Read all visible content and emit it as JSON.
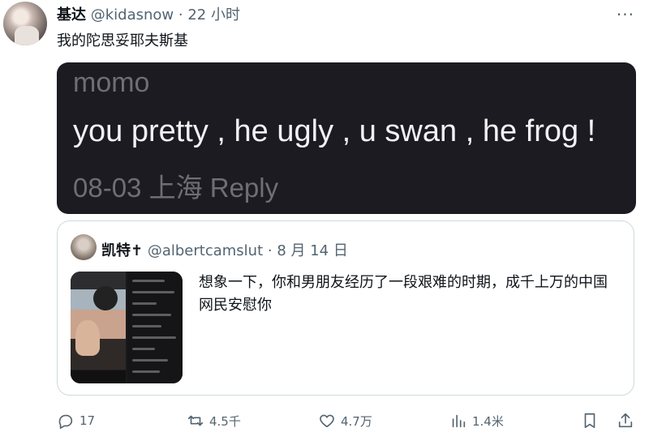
{
  "tweet": {
    "author_name": "基达",
    "author_handle": "@kidasnow",
    "separator": "·",
    "time": "22 小时",
    "text": "我的陀思妥耶夫斯基",
    "more_label": "···"
  },
  "embedded_image": {
    "username": "momo",
    "message": "you pretty , he ugly , u swan , he frog !",
    "meta": "08-03 上海 Reply"
  },
  "quoted_tweet": {
    "author_name": "凯特",
    "name_suffix": "✝",
    "author_handle": "@albertcamslut",
    "separator": "·",
    "time": "8 月 14 日",
    "text": "想象一下，你和男朋友经历了一段艰难的时期，成千上万的中国网民安慰你"
  },
  "actions": {
    "replies": "17",
    "retweets": "4.5千",
    "likes": "4.7万",
    "views": "1.4米"
  },
  "icons": {
    "reply": "reply-icon",
    "retweet": "retweet-icon",
    "like": "heart-icon",
    "views": "views-icon",
    "bookmark": "bookmark-icon",
    "share": "share-icon"
  }
}
